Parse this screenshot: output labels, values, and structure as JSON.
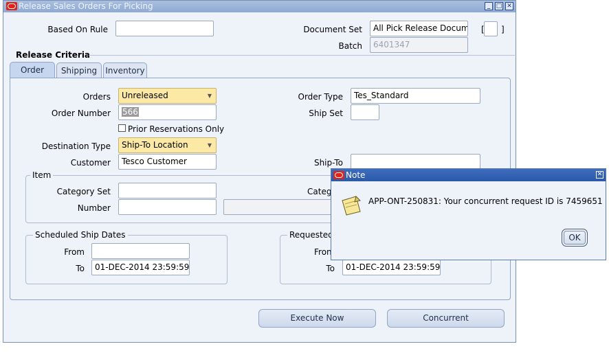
{
  "window": {
    "title": "Release Sales Orders For Picking"
  },
  "header": {
    "based_on_rule_label": "Based On Rule",
    "based_on_rule_value": "",
    "document_set_label": "Document Set",
    "document_set_value": "All Pick Release Docum",
    "batch_label": "Batch",
    "batch_value": "6401347",
    "bracket_open": "[",
    "bracket_close": "]"
  },
  "release_criteria": {
    "title": "Release Criteria",
    "tabs": [
      {
        "label": "Order",
        "active": true
      },
      {
        "label": "Shipping",
        "active": false
      },
      {
        "label": "Inventory",
        "active": false
      }
    ]
  },
  "order_tab": {
    "orders_label": "Orders",
    "orders_value": "Unreleased",
    "order_number_label": "Order Number",
    "order_number_value": "566",
    "prior_reservations_label": "Prior Reservations Only",
    "prior_reservations_checked": false,
    "destination_type_label": "Destination Type",
    "destination_type_value": "Ship-To Location",
    "customer_label": "Customer",
    "customer_value": "Tesco Customer",
    "order_type_label": "Order Type",
    "order_type_value": "Tes_Standard",
    "ship_set_label": "Ship Set",
    "ship_set_value": "",
    "ship_to_label": "Ship-To",
    "ship_to_value": "",
    "item_group": {
      "title": "Item",
      "category_set_label": "Category Set",
      "category_set_value": "",
      "number_label": "Number",
      "number_value": "",
      "category_label_partial": "Categ"
    },
    "scheduled_ship_dates": {
      "title": "Scheduled Ship Dates",
      "from_label": "From",
      "from_value": "",
      "to_label": "To",
      "to_value": "01-DEC-2014 23:59:59"
    },
    "requested_dates": {
      "title_partial": "Requested",
      "from_label_partial": "Fron",
      "to_label": "To",
      "to_value": "01-DEC-2014 23:59:59"
    }
  },
  "buttons": {
    "execute_now": "Execute Now",
    "concurrent": "Concurrent"
  },
  "note": {
    "title": "Note",
    "message": "APP-ONT-250831: Your concurrent request ID is 7459651",
    "ok_label": "OK"
  },
  "colors": {
    "required_field": "#fce9a6",
    "window_bg": "#eef2f9",
    "note_titlebar": "#2b59ab",
    "oracle_red": "#e0231a"
  }
}
